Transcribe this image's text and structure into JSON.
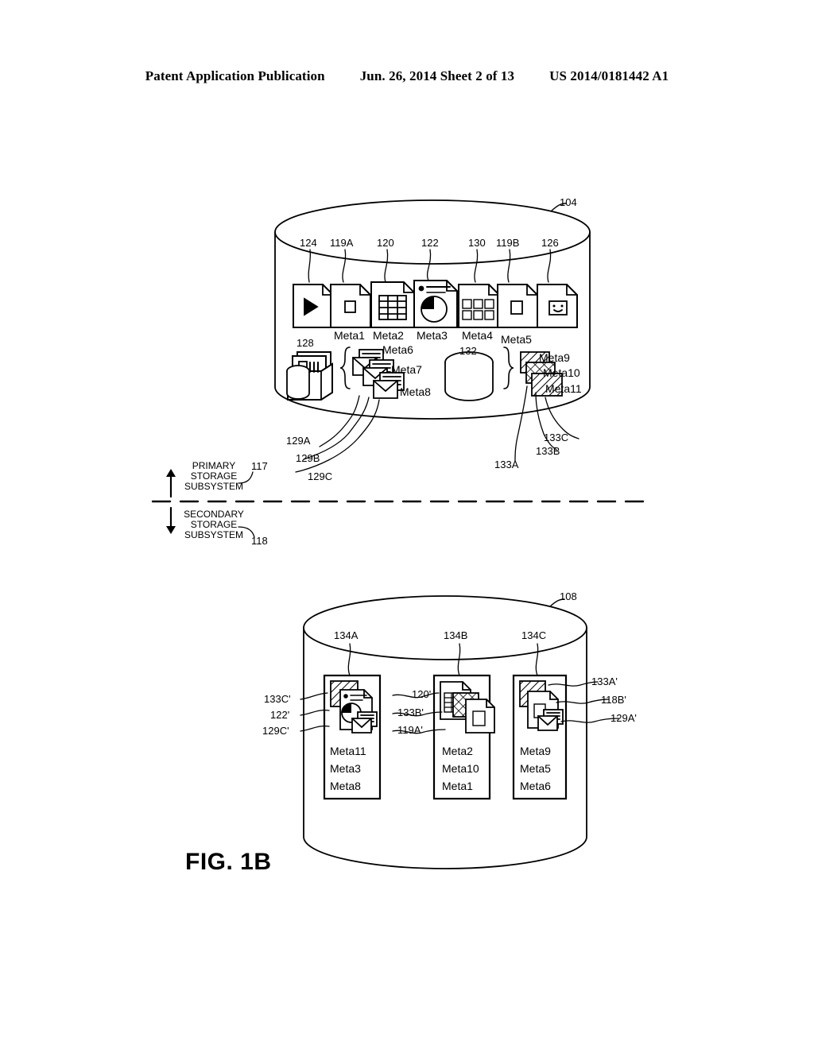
{
  "header": {
    "publication": "Patent Application Publication",
    "date_sheet": "Jun. 26, 2014  Sheet 2 of 13",
    "patent_number": "US 2014/0181442 A1"
  },
  "figure": {
    "caption": "FIG. 1B"
  },
  "primary_storage": {
    "cylinder_ref": "104",
    "subsystem_label_line1": "PRIMARY",
    "subsystem_label_line2": "STORAGE",
    "subsystem_label_line3": "SUBSYSTEM",
    "subsystem_ref": "117",
    "top_refs": [
      "124",
      "119A",
      "120",
      "122",
      "130",
      "119B",
      "126"
    ],
    "documents": [
      {
        "ref": "124",
        "icon": "play-document-icon",
        "meta": ""
      },
      {
        "ref": "119A",
        "icon": "square-document-icon",
        "meta": "Meta1"
      },
      {
        "ref": "120",
        "icon": "spreadsheet-document-icon",
        "meta": "Meta2"
      },
      {
        "ref": "122",
        "icon": "piechart-document-icon",
        "meta": "Meta3"
      },
      {
        "ref": "130",
        "icon": "unknown-grid-document-icon",
        "meta": "Meta4"
      },
      {
        "ref": "119B",
        "icon": "square-document-icon",
        "meta": "Meta5"
      },
      {
        "ref": "126",
        "icon": "smiley-document-icon",
        "meta": ""
      }
    ],
    "archive": {
      "ref": "128",
      "icon": "archive-box-icon"
    },
    "mail": {
      "icon": "envelope-stack-icon",
      "metas": [
        "Meta6",
        "Meta7",
        "Meta8"
      ],
      "refs": [
        "129A",
        "129B",
        "129C"
      ]
    },
    "database": {
      "ref": "132",
      "icon": "database-cylinder-icon"
    },
    "blocks": {
      "icon": "hatched-block-stack-icon",
      "metas": [
        "Meta9",
        "Meta10",
        "Meta11"
      ],
      "refs": [
        "133A",
        "133B",
        "133C"
      ]
    }
  },
  "secondary_storage": {
    "cylinder_ref": "108",
    "subsystem_label_line1": "SECONDARY",
    "subsystem_label_line2": "STORAGE",
    "subsystem_label_line3": "SUBSYSTEM",
    "subsystem_ref": "118",
    "containers": [
      {
        "ref": "134A",
        "icons": [
          "hatched-block-icon",
          "bullet-piechart-document-icon",
          "envelope-icon"
        ],
        "metas": [
          "Meta11",
          "Meta3",
          "Meta8"
        ],
        "left_refs": [
          "133C'",
          "122'",
          "129C'"
        ]
      },
      {
        "ref": "134B",
        "icons": [
          "spreadsheet-document-icon",
          "crosshatched-block-icon",
          "question-document-icon"
        ],
        "metas": [
          "Meta2",
          "Meta10",
          "Meta1"
        ],
        "left_refs": [
          "120'",
          "133B'",
          "119A'"
        ]
      },
      {
        "ref": "134C",
        "icons": [
          "hatched-block-icon",
          "question-document-icon",
          "envelope-icon"
        ],
        "metas": [
          "Meta9",
          "Meta5",
          "Meta6"
        ],
        "right_refs": [
          "133A'",
          "118B'",
          "129A'"
        ]
      }
    ]
  }
}
